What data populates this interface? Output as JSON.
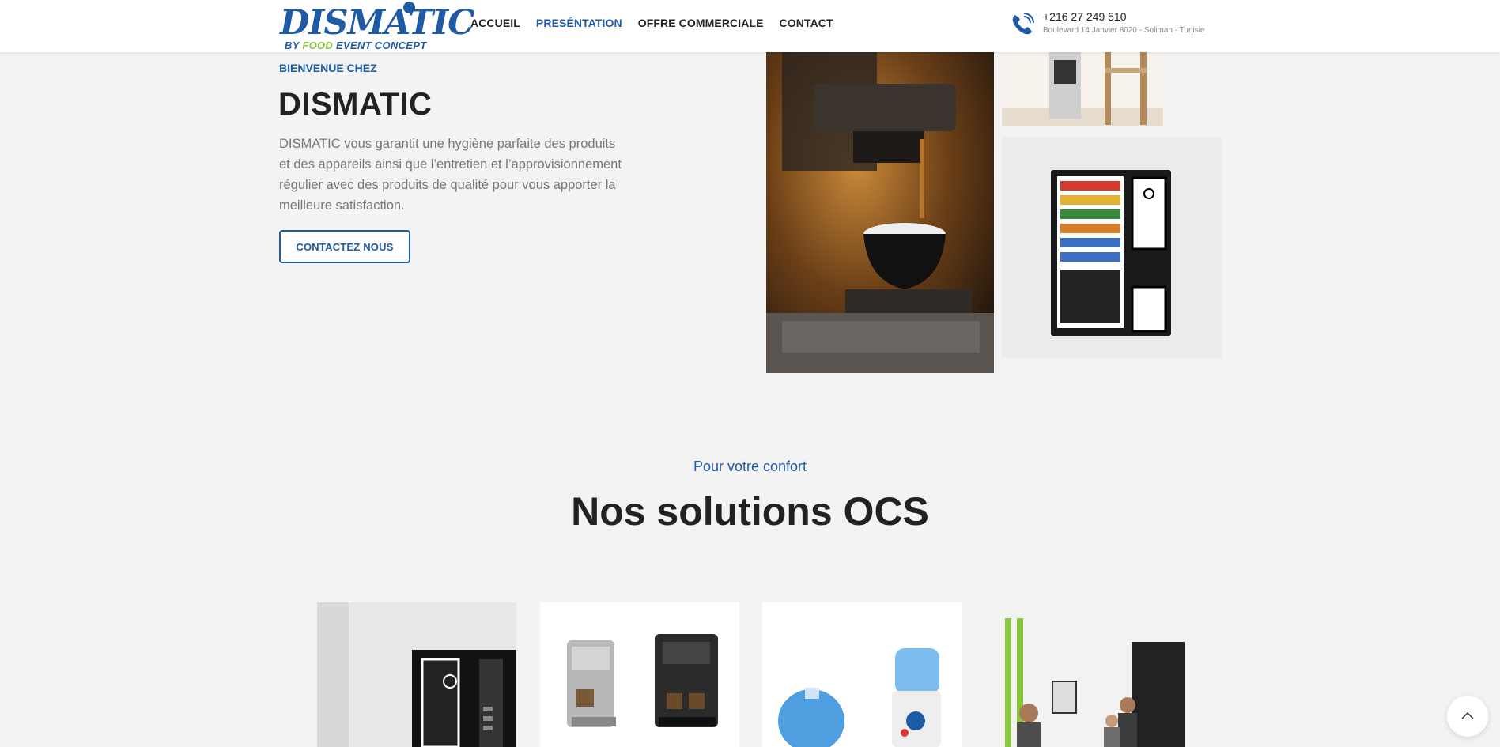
{
  "brand": {
    "name": "DISMATIC",
    "tagline_prefix": "BY ",
    "tagline_food": "FOOD",
    "tagline_suffix": " EVENT CONCEPT"
  },
  "nav": {
    "items": [
      "ACCUEIL",
      "PRESÉNTATION",
      "OFFRE COMMERCIALE",
      "CONTACT"
    ],
    "active": "PRESÉNTATION"
  },
  "contact": {
    "phone": "+216 27 249 510",
    "address": "Boulevard 14 Janvier 8020 - Soliman - Tunisie"
  },
  "hero": {
    "eyebrow": "BIENVENUE CHEZ",
    "title": "DISMATIC",
    "text": "DISMATIC vous garantit une hygiène parfaite des produits et des appareils ainsi que l’entretien et l’approvisionnement régulier avec des produits de qualité pour vous apporter la meilleure satisfaction.",
    "cta_label": "CONTACTEZ NOUS"
  },
  "section": {
    "subtitle": "Pour votre confort",
    "title": "Nos solutions OCS"
  },
  "colors": {
    "brand_blue": "#1f5aa6",
    "brand_green": "#8bc43f",
    "background": "#f3f3f3"
  },
  "icons": {
    "phone": "phone-icon",
    "scroll_top": "chevron-up-icon"
  }
}
